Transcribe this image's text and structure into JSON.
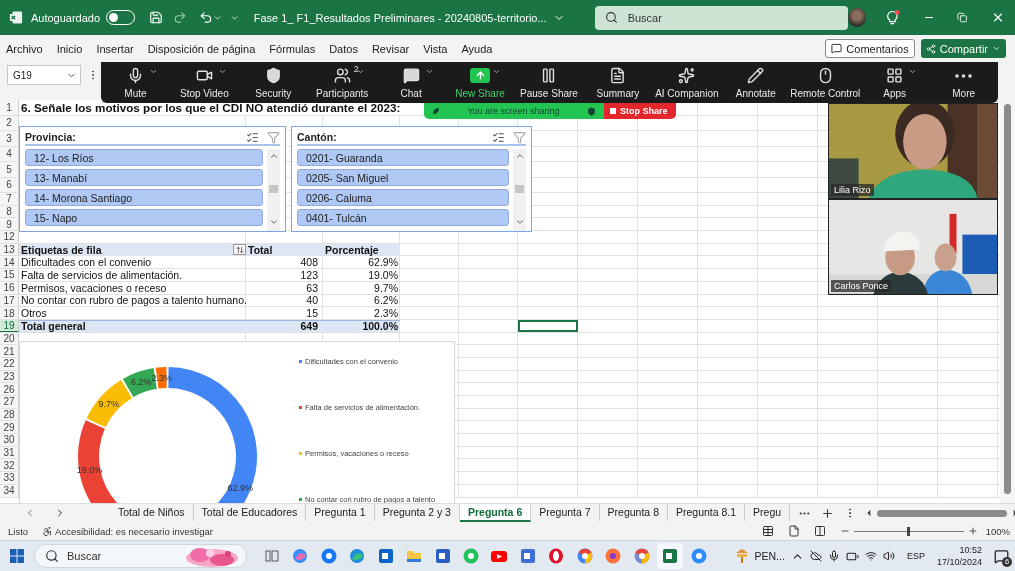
{
  "title_bar": {
    "autosave_label": "Autoguardado",
    "autosave_on": false,
    "file_name": "Fase 1_ F1_Resultados Preliminares - 20240805-territorio...",
    "search_placeholder": "Buscar"
  },
  "menu": [
    "Archivo",
    "Inicio",
    "Insertar",
    "Disposición de página",
    "Fórmulas",
    "Datos",
    "Revisar",
    "Vista",
    "Ayuda"
  ],
  "comments_button": "Comentarios",
  "share_button": "Compartir",
  "name_box": "G19",
  "zoom_toolbar": [
    {
      "kind": "mic",
      "label": "Mute",
      "caret": true
    },
    {
      "kind": "video",
      "label": "Stop Video",
      "caret": true
    },
    {
      "kind": "security",
      "label": "Security",
      "caret": false
    },
    {
      "kind": "participants",
      "label": "Participants",
      "caret": true,
      "count": "2"
    },
    {
      "kind": "chat",
      "label": "Chat",
      "caret": true
    },
    {
      "kind": "share",
      "label": "New Share",
      "caret": true
    },
    {
      "kind": "pause",
      "label": "Pause Share",
      "caret": false
    },
    {
      "kind": "summary",
      "label": "Summary",
      "caret": false
    },
    {
      "kind": "ai",
      "label": "AI Companion",
      "caret": false
    },
    {
      "kind": "annotate",
      "label": "Annotate",
      "caret": false
    },
    {
      "kind": "remote",
      "label": "Remote Control",
      "caret": false
    },
    {
      "kind": "apps",
      "label": "Apps",
      "caret": true
    },
    {
      "kind": "more",
      "label": "More",
      "caret": false
    }
  ],
  "sharing_banner": {
    "text": "You are screen sharing",
    "stop_label": "Stop Share"
  },
  "video_tiles": [
    {
      "kind": "picture",
      "name": "Lilia Rizo"
    },
    {
      "kind": "picture",
      "name": "Carlos Ponce"
    }
  ],
  "sheet": {
    "rows": [
      {
        "number": "1",
        "selected": false,
        "kind": "title",
        "cells": [
          "6. Señale los motivos por los que el CDI NO atendió durante el 2023:"
        ]
      },
      {
        "number": "2",
        "selected": false,
        "kind": "blank"
      },
      {
        "number": "3",
        "selected": false,
        "kind": "blank"
      },
      {
        "number": "4",
        "selected": false,
        "kind": "blank"
      },
      {
        "number": "5",
        "selected": false,
        "kind": "blank"
      },
      {
        "number": "6",
        "selected": false,
        "kind": "blank"
      },
      {
        "number": "7",
        "selected": false,
        "kind": "blank"
      },
      {
        "number": "8",
        "selected": false,
        "kind": "blank"
      },
      {
        "number": "9",
        "selected": false,
        "kind": "blank"
      },
      {
        "number": "12",
        "selected": false,
        "kind": "blank"
      },
      {
        "number": "13",
        "selected": false,
        "kind": "pivot_header",
        "cells": [
          "Etiquetas de fila",
          "Total",
          "Porcentaje"
        ]
      },
      {
        "number": "14",
        "selected": false,
        "kind": "pivot_row",
        "cells": [
          "Dificultades con el convenio",
          "408",
          "62.9%"
        ]
      },
      {
        "number": "15",
        "selected": false,
        "kind": "pivot_row",
        "cells": [
          "Falta de servicios de alimentación.",
          "123",
          "19.0%"
        ]
      },
      {
        "number": "16",
        "selected": false,
        "kind": "pivot_row",
        "cells": [
          "Permisos, vacaciones o receso",
          "63",
          "9.7%"
        ]
      },
      {
        "number": "17",
        "selected": false,
        "kind": "pivot_row",
        "cells": [
          "No contar con rubro de pagos a talento humano.",
          "40",
          "6.2%"
        ]
      },
      {
        "number": "18",
        "selected": false,
        "kind": "pivot_row",
        "cells": [
          "Otros",
          "15",
          "2.3%"
        ]
      },
      {
        "number": "19",
        "selected": true,
        "kind": "pivot_total",
        "cells": [
          "Total general",
          "649",
          "100.0%"
        ]
      },
      {
        "number": "20",
        "selected": false,
        "kind": "blank"
      },
      {
        "number": "21",
        "selected": false,
        "kind": "blank"
      },
      {
        "number": "22",
        "selected": false,
        "kind": "blank"
      },
      {
        "number": "23",
        "selected": false,
        "kind": "blank"
      },
      {
        "number": "26",
        "selected": false,
        "kind": "blank"
      },
      {
        "number": "27",
        "selected": false,
        "kind": "blank"
      },
      {
        "number": "28",
        "selected": false,
        "kind": "blank"
      },
      {
        "number": "29",
        "selected": false,
        "kind": "blank"
      },
      {
        "number": "30",
        "selected": false,
        "kind": "blank"
      },
      {
        "number": "31",
        "selected": false,
        "kind": "blank"
      },
      {
        "number": "32",
        "selected": false,
        "kind": "blank"
      },
      {
        "number": "33",
        "selected": false,
        "kind": "blank"
      },
      {
        "number": "34",
        "selected": false,
        "kind": "blank"
      }
    ]
  },
  "slicers": [
    {
      "title": "Provincia:",
      "items": [
        "12- Los Ríos",
        "13- Manabí",
        "14- Morona Santiago",
        "15- Napo"
      ]
    },
    {
      "title": "Cantón:",
      "items": [
        "0201- Guaranda",
        "0205- San Miguel",
        "0206- Caluma",
        "0401- Tulcán"
      ]
    }
  ],
  "chart": {
    "legend": [
      {
        "label": "Dificultades con el convenio",
        "color": "#4285f4"
      },
      {
        "label": "Falta de servicios de alimentación.",
        "color": "#ea4335"
      },
      {
        "label": "Permisos, vacaciones o receso",
        "color": "#fbbc04"
      },
      {
        "label": "No contar con rubro de pagos a talento",
        "color": "#34a853"
      }
    ],
    "slices": [
      {
        "color": "#4285f4"
      },
      {
        "color": "#ea4335"
      },
      {
        "color": "#fbbc04"
      },
      {
        "color": "#34a853"
      },
      {
        "color": "#ff6d01"
      }
    ],
    "chart_data": {
      "type": "donut",
      "values": [
        62.9,
        19.0,
        9.7,
        6.2,
        2.3
      ],
      "data_labels": true,
      "value_labels": [
        "62.9%",
        "19.0%",
        "9.7%",
        "6.2%",
        "2.3%"
      ]
    }
  },
  "sheet_tabs": [
    {
      "label": "Total de Niños",
      "selected": false
    },
    {
      "label": "Total de Educadores",
      "selected": false
    },
    {
      "label": "Pregunta 1",
      "selected": false
    },
    {
      "label": "Pregunta 2 y 3",
      "selected": false
    },
    {
      "label": "Pregunta 6",
      "selected": true
    },
    {
      "label": "Pregunta 7",
      "selected": false
    },
    {
      "label": "Pregunta 8",
      "selected": false
    },
    {
      "label": "Pregunta 8.1",
      "selected": false
    },
    {
      "label": "Pregu",
      "selected": false
    }
  ],
  "status_bar": {
    "ready": "Listo",
    "accessibility": "Accesibilidad: es necesario investigar",
    "zoom": "100%",
    "level": 0.5
  },
  "taskbar": {
    "search_placeholder": "Buscar",
    "apps": [
      {
        "kind": "taskview",
        "active": false
      },
      {
        "kind": "copilot",
        "active": false
      },
      {
        "kind": "facebook",
        "active": false
      },
      {
        "kind": "edge",
        "active": false
      },
      {
        "kind": "outlook",
        "active": false
      },
      {
        "kind": "explorer",
        "active": false
      },
      {
        "kind": "word",
        "active": false
      },
      {
        "kind": "whatsapp",
        "active": false
      },
      {
        "kind": "youtube",
        "active": false
      },
      {
        "kind": "store",
        "active": false
      },
      {
        "kind": "opera",
        "active": false
      },
      {
        "kind": "chrome",
        "active": false
      },
      {
        "kind": "firefox",
        "active": false
      },
      {
        "kind": "settings",
        "active": false
      },
      {
        "kind": "excel",
        "active": true
      },
      {
        "kind": "zoom",
        "active": false
      }
    ],
    "pinned_label": "PEN...",
    "language": "ESP",
    "time": "10:52",
    "date": "17/10/2024",
    "notification_count": "6"
  }
}
